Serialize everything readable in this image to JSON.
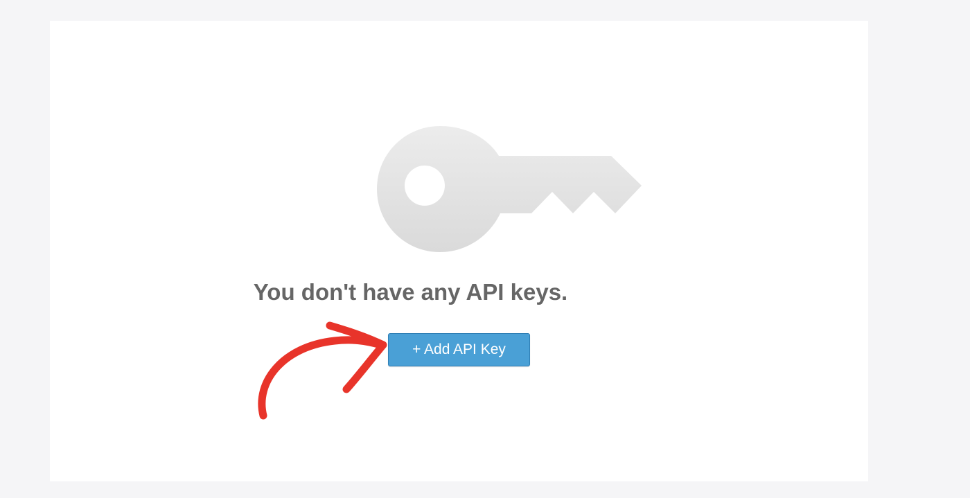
{
  "empty_state": {
    "message": "You don't have any API keys.",
    "icon": "key-icon",
    "add_button_label": "+ Add API Key"
  },
  "annotation": {
    "icon": "red-arrow-icon",
    "color": "#e8342a"
  },
  "colors": {
    "page_background": "#f5f5f7",
    "card_background": "#ffffff",
    "icon_gray": "#e0e0e0",
    "title_text": "#666666",
    "button_background": "#4aa0d6",
    "button_border": "#2f7fb5"
  }
}
